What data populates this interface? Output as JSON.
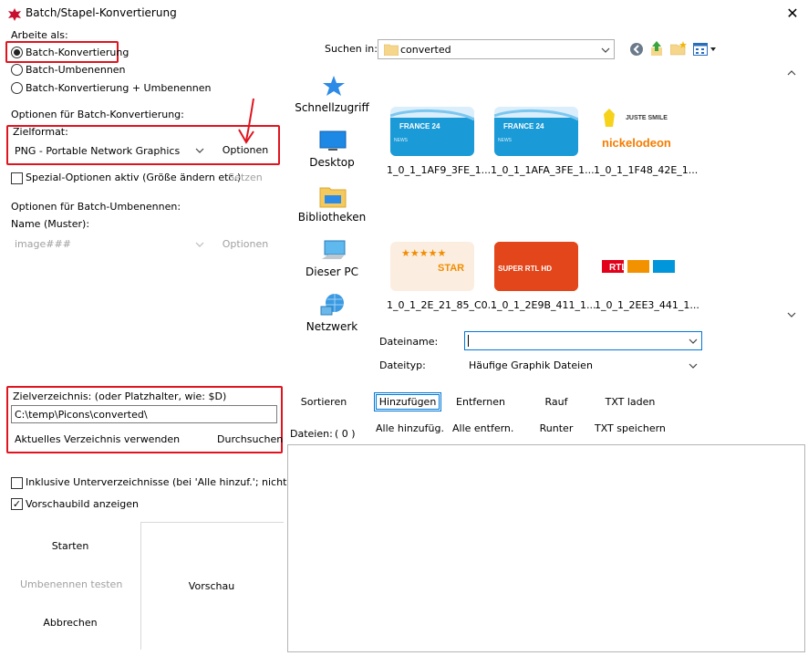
{
  "window": {
    "title": "Batch/Stapel-Konvertierung",
    "close": "✕"
  },
  "left": {
    "arbeite_als": "Arbeite als:",
    "mode_options": [
      "Batch-Konvertierung",
      "Batch-Umbenennen",
      "Batch-Konvertierung + Umbenennen"
    ],
    "mode_selected": 0,
    "convert_section_label": "Optionen für Batch-Konvertierung:",
    "zielformat_label": "Zielformat:",
    "zielformat_value": "PNG - Portable Network Graphics",
    "optionen_button": "Optionen",
    "spezial_label": "Spezial-Optionen aktiv (Größe ändern etc.)",
    "setzen_button": "Setzen",
    "rename_section_label": "Optionen für Batch-Umbenennen:",
    "name_label": "Name (Muster):",
    "name_value": "image###",
    "rename_optionen_button": "Optionen",
    "zielverzeichnis_label": "Zielverzeichnis: (oder Platzhalter, wie: $D)",
    "zielverzeichnis_value": "C:\\temp\\Picons\\converted\\",
    "aktuelles_button": "Aktuelles Verzeichnis verwenden",
    "durchsuchen_button": "Durchsuchen",
    "inklusive_label": "Inklusive Unterverzeichnisse (bei 'Alle hinzuf.'; nicht gesp.)",
    "vorschau_label": "Vorschaubild anzeigen",
    "starten_button": "Starten",
    "umbenennen_button": "Umbenennen testen",
    "abbrechen_button": "Abbrechen",
    "vorschau_area": "Vorschau"
  },
  "browser": {
    "suchen_label": "Suchen in:",
    "folder": "converted",
    "places": [
      "Schnellzugriff",
      "Desktop",
      "Bibliotheken",
      "Dieser PC",
      "Netzwerk"
    ],
    "thumbnails": [
      {
        "caption": "1_0_1_1AF9_3FE_1...",
        "logo": "FRANCE 24"
      },
      {
        "caption": "1_0_1_1AFA_3FE_1...",
        "logo": "FRANCE 24"
      },
      {
        "caption": "1_0_1_1F48_42E_1...",
        "logo": "nickelodeon"
      },
      {
        "caption": "1_0_1_2E_21_85_C0...",
        "logo": "STAR"
      },
      {
        "caption": "1_0_1_2E9B_411_1...",
        "logo": "SUPER RTL HD"
      },
      {
        "caption": "1_0_1_2EE3_441_1...",
        "logo": "RTL"
      }
    ],
    "nick_top": "JUSTE SMILE",
    "news_text": "NEWS",
    "dateiname_label": "Dateiname:",
    "dateiname_value": "",
    "dateityp_label": "Dateityp:",
    "dateityp_value": "Häufige Graphik Dateien"
  },
  "actions": {
    "sortieren": "Sortieren",
    "hinzufuegen": "Hinzufügen",
    "entfernen": "Entfernen",
    "rauf": "Rauf",
    "txt_laden": "TXT laden",
    "dateien_label": "Dateien:",
    "dateien_count": "( 0 )",
    "alle_hinzufuegen": "Alle hinzufüg.",
    "alle_entfernen": "Alle entfern.",
    "runter": "Runter",
    "txt_speichern": "TXT speichern"
  },
  "colors": {
    "accent": "#0078d7",
    "highlight": "#e0141e"
  }
}
